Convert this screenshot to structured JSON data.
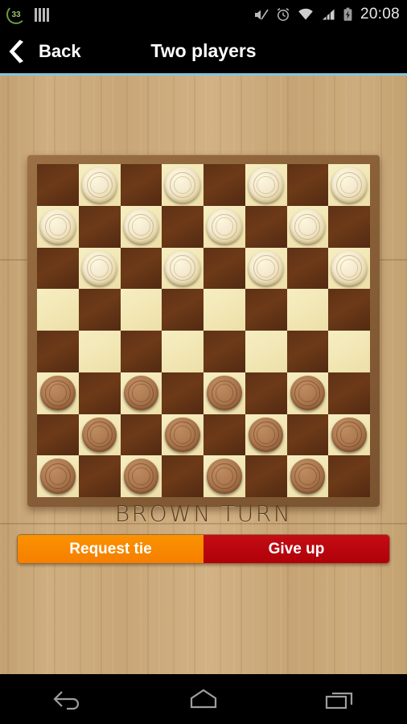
{
  "status_bar": {
    "download_badge": "33",
    "download_icon": "circular-progress-icon",
    "bars_icon": "signal-bars-icon",
    "right_icons": [
      "mute-icon",
      "alarm-icon",
      "wifi-icon",
      "cellular-signal-icon",
      "battery-charging-icon"
    ],
    "time": "20:08"
  },
  "action_bar": {
    "back_icon": "chevron-left-icon",
    "back_label": "Back",
    "title": "Two players"
  },
  "game": {
    "turn_text": "BROWN TURN",
    "board_size": 8,
    "colors": {
      "light_square": "#f2e6b4",
      "dark_square": "#6d3a18",
      "white_piece": "#f4ead0",
      "brown_piece": "#b07c52",
      "board_frame": "#8a6138",
      "wood_background": "#c8a677",
      "accent_line": "#7fc7de"
    },
    "board": [
      [
        null,
        "white",
        null,
        "white",
        null,
        "white",
        null,
        "white"
      ],
      [
        "white",
        null,
        "white",
        null,
        "white",
        null,
        "white",
        null
      ],
      [
        null,
        "white",
        null,
        "white",
        null,
        "white",
        null,
        "white"
      ],
      [
        null,
        null,
        null,
        null,
        null,
        null,
        null,
        null
      ],
      [
        null,
        null,
        null,
        null,
        null,
        null,
        null,
        null
      ],
      [
        "brown",
        null,
        "brown",
        null,
        "brown",
        null,
        "brown",
        null
      ],
      [
        null,
        "brown",
        null,
        "brown",
        null,
        "brown",
        null,
        "brown"
      ],
      [
        "brown",
        null,
        "brown",
        null,
        "brown",
        null,
        "brown",
        null
      ]
    ]
  },
  "buttons": {
    "request_tie": "Request tie",
    "give_up": "Give up"
  },
  "nav_bar": {
    "back": "nav-back-icon",
    "home": "nav-home-icon",
    "recents": "nav-recents-icon"
  }
}
